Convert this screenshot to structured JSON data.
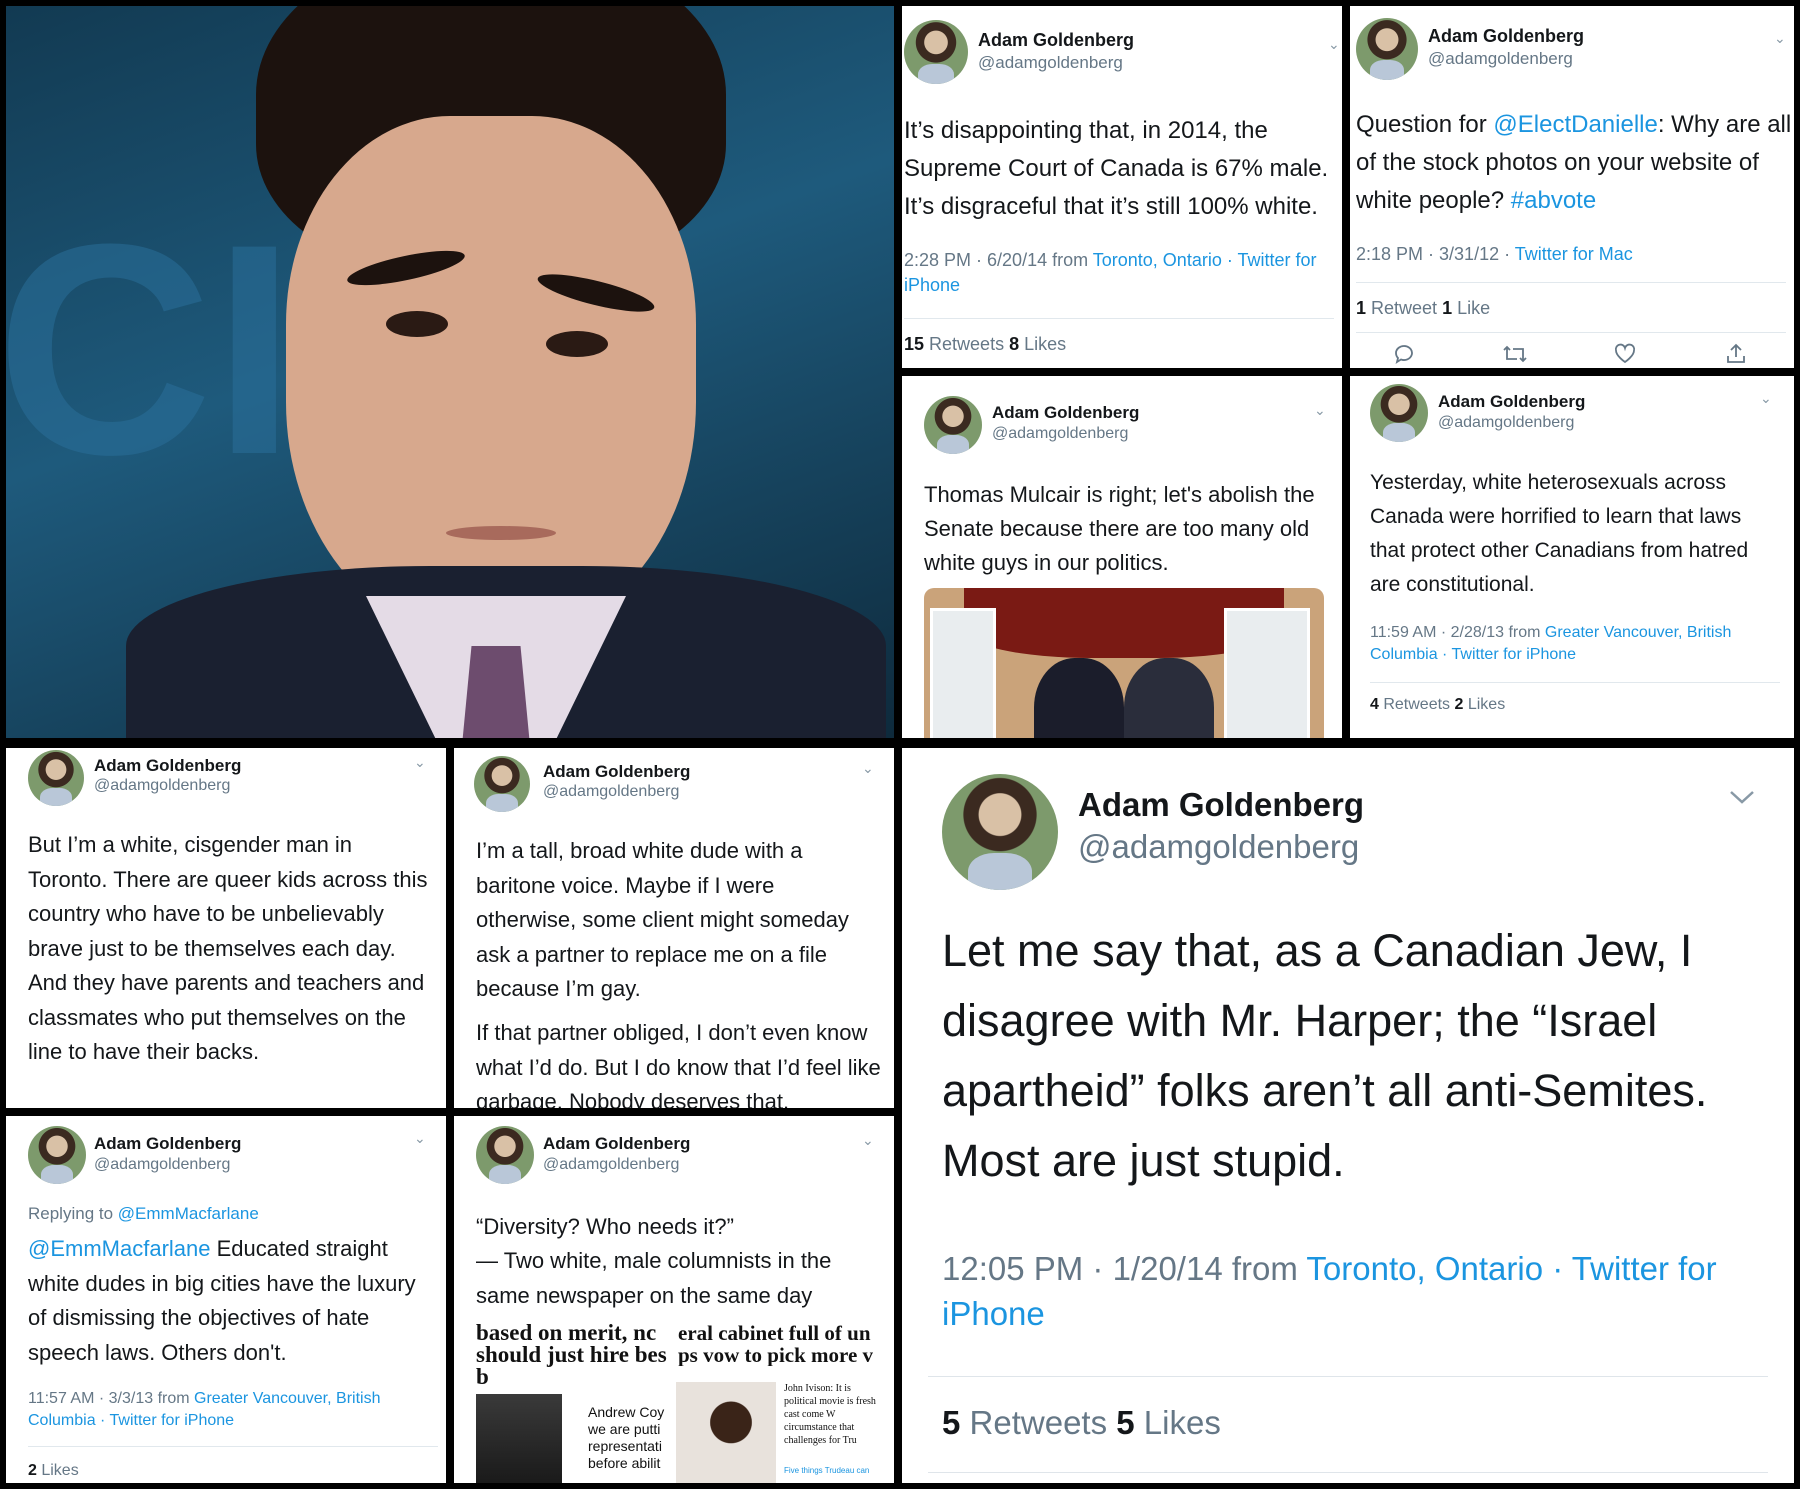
{
  "author": {
    "name": "Adam Goldenberg",
    "handle": "@adamgoldenberg",
    "chevron": "chevron-down-icon"
  },
  "photo": {
    "backdrop_text": "CI"
  },
  "tweet_scc": {
    "text": "It’s disappointing that, in 2014, the Supreme Court of Canada is 67% male. It’s disgraceful that it’s still 100% white.",
    "time": "2:28 PM · 6/20/14 from ",
    "location": "Toronto, Ontario",
    "sep": " · ",
    "client": "Twitter for iPhone",
    "retweets": "15",
    "retweets_label": " Retweets ",
    "likes": "8",
    "likes_label": " Likes"
  },
  "tweet_stock": {
    "text_pre": "Question for ",
    "mention": "@ElectDanielle",
    "text_mid": ": Why are all of the stock photos on your website of white people? ",
    "hashtag": "#abvote",
    "time": "2:18 PM · 3/31/12 · ",
    "client": "Twitter for Mac",
    "retweets": "1",
    "retweets_label": " Retweet ",
    "likes": "1",
    "likes_label": " Like",
    "actions": [
      "reply-icon",
      "retweet-icon",
      "like-icon",
      "share-icon"
    ]
  },
  "tweet_senate": {
    "text": "Thomas Mulcair is right; let's abolish the Senate because there are too many old white guys in our politics."
  },
  "tweet_hetero": {
    "text": "Yesterday, white heterosexuals across Canada were horrified to learn that laws that protect other Canadians from hatred are constitutional.",
    "time": "11:59 AM · 2/28/13 from ",
    "location": "Greater Vancouver, British Columbia",
    "sep": " · ",
    "client": "Twitter for iPhone",
    "retweets": "4",
    "retweets_label": " Retweets ",
    "likes": "2",
    "likes_label": " Likes"
  },
  "tweet_cis": {
    "text": "But I’m a white, cisgender man in Toronto. There are queer kids across this country who have to be unbelievably brave just to be themselves each day. And they have parents and teachers and classmates who put themselves on the line to have their backs."
  },
  "tweet_tall": {
    "para1": "I’m a tall, broad white dude with a baritone voice. Maybe if I were otherwise, some client might someday ask a partner to replace me on a file because I’m gay.",
    "para2": "If that partner obliged, I don’t even know what I’d do. But I do know that I’d feel like garbage. Nobody deserves that."
  },
  "tweet_reply": {
    "replying_to": "Replying to ",
    "reply_handle": "@EmmMacfarlane",
    "mention": "@EmmMacfarlane",
    "text": " Educated straight white dudes in big cities have the luxury of dismissing the objectives of hate speech laws. Others don't.",
    "time": "11:57 AM · 3/3/13 from ",
    "location": "Greater Vancouver, British Columbia",
    "sep": " · ",
    "client": "Twitter for iPhone",
    "likes": "2",
    "likes_label": " Likes"
  },
  "tweet_diversity": {
    "line1": "“Diversity? Who needs it?”",
    "line2": "— Two white, male columnists in the same newspaper on the same day",
    "clip_left_1": "based on merit, nc",
    "clip_left_2": "should just hire bes",
    "clip_left_3": "b",
    "clip_right_1": "eral cabinet full of un",
    "clip_right_2": "ps vow to pick more v",
    "col_a": "Andrew Coy we are putti representati before abilit",
    "col_b": "John Ivison: It is political movie is fresh cast come W circumstance that challenges for Tru",
    "col_b_foot": "Five things Trudeau can"
  },
  "tweet_israel": {
    "text": "Let me say that, as a Canadian Jew, I disagree with Mr. Harper; the “Israel apartheid” folks aren’t all anti-Semites. Most are just stupid.",
    "time": "12:05 PM · 1/20/14 from ",
    "location": "Toronto, Ontario",
    "sep": " · ",
    "client": "Twitter for iPhone",
    "retweets": "5",
    "retweets_label": " Retweets ",
    "likes": "5",
    "likes_label": " Likes"
  },
  "colors": {
    "link": "#1b95e0",
    "muted": "#657786",
    "text": "#14171a",
    "border": "#000000"
  }
}
